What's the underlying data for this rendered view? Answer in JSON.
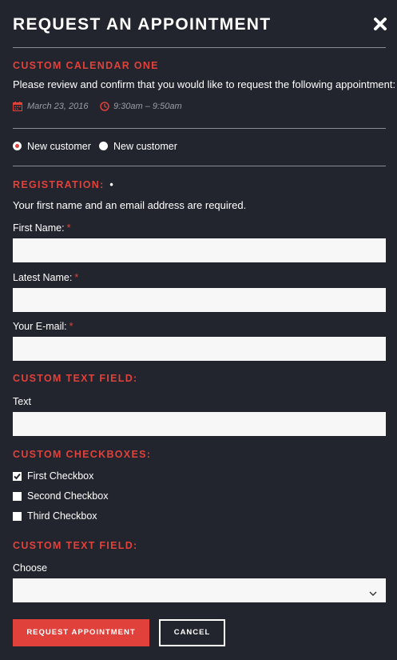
{
  "modal": {
    "title": "REQUEST AN APPOINTMENT",
    "close_icon": "close-icon"
  },
  "calendar": {
    "name": "CUSTOM CALENDAR ONE",
    "instructions": "Please review and confirm that you would like to request the following appointment:",
    "date": "March 23, 2016",
    "time": "9:30am – 9:50am",
    "date_icon": "calendar-icon",
    "time_icon": "clock-icon"
  },
  "customer_type": {
    "options": [
      {
        "label": "New customer",
        "selected": true
      },
      {
        "label": "New customer",
        "selected": false
      }
    ]
  },
  "registration": {
    "heading": "REGISTRATION:",
    "heading_marker": "•",
    "note": "Your first name and an email address are required.",
    "required_marker": "*",
    "fields": [
      {
        "label": "First Name:",
        "value": ""
      },
      {
        "label": "Latest Name:",
        "value": ""
      },
      {
        "label": "Your E-mail:",
        "value": ""
      }
    ]
  },
  "custom_text_field": {
    "heading": "CUSTOM TEXT FIELD:",
    "label": "Text",
    "value": ""
  },
  "custom_checkboxes": {
    "heading": "CUSTOM CHECKBOXES:",
    "items": [
      {
        "label": "First Checkbox",
        "checked": true
      },
      {
        "label": "Second Checkbox",
        "checked": false
      },
      {
        "label": "Third Checkbox",
        "checked": false
      }
    ]
  },
  "custom_select_field": {
    "heading": "CUSTOM TEXT FIELD:",
    "label": "Choose",
    "value": ""
  },
  "actions": {
    "submit_label": "REQUEST APPOINTMENT",
    "cancel_label": "CANCEL"
  },
  "colors": {
    "background": "#23252e",
    "accent": "#e0413a",
    "text": "#ffffff",
    "muted": "#9a9da6",
    "input_bg": "#f7f7f7"
  }
}
